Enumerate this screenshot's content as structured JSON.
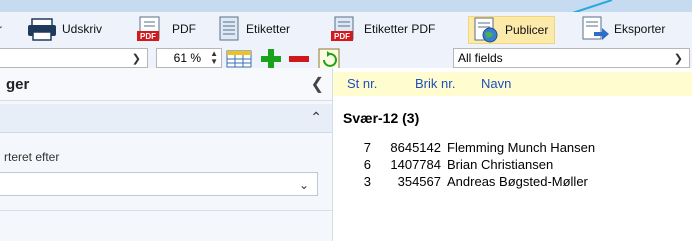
{
  "toolbar": {
    "items": [
      {
        "label": "Udskriv",
        "icon": "printer-icon"
      },
      {
        "label": "PDF",
        "icon": "pdf-icon"
      },
      {
        "label": "Etiketter",
        "icon": "labels-icon"
      },
      {
        "label": "Etiketter PDF",
        "icon": "labels-pdf-icon"
      },
      {
        "label": "Publicer",
        "icon": "publish-icon",
        "active": true
      },
      {
        "label": "Eksporter",
        "icon": "export-icon"
      }
    ],
    "zoom": "61 %",
    "field_select": "All fields",
    "colors": {
      "accent": "#fbeaaa",
      "bar": "#c6dbef",
      "add": "#1aa31a",
      "remove": "#d01818"
    }
  },
  "left_panel": {
    "title": "ger",
    "sort_label": "rteret efter"
  },
  "list": {
    "headers": [
      "St nr.",
      "Brik nr.",
      "Navn"
    ],
    "group": "Svær-12  (3)",
    "rows": [
      {
        "st": "7",
        "brik": "8645142",
        "navn": "Flemming Munch Hansen"
      },
      {
        "st": "6",
        "brik": "1407784",
        "navn": "Brian Christiansen"
      },
      {
        "st": "3",
        "brik": "354567",
        "navn": "Andreas Bøgsted-Møller"
      }
    ]
  }
}
